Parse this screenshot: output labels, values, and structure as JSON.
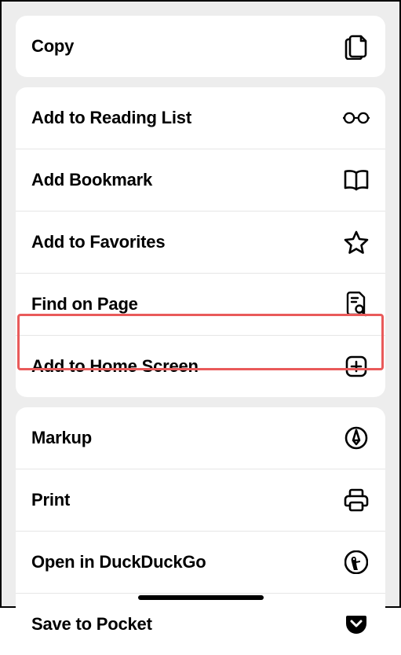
{
  "actions": {
    "copy": "Copy",
    "addReadingList": "Add to Reading List",
    "addBookmark": "Add Bookmark",
    "addFavorites": "Add to Favorites",
    "findOnPage": "Find on Page",
    "addHomeScreen": "Add to Home Screen",
    "markup": "Markup",
    "print": "Print",
    "openDuckDuckGo": "Open in DuckDuckGo",
    "saveToPocket": "Save to Pocket"
  }
}
